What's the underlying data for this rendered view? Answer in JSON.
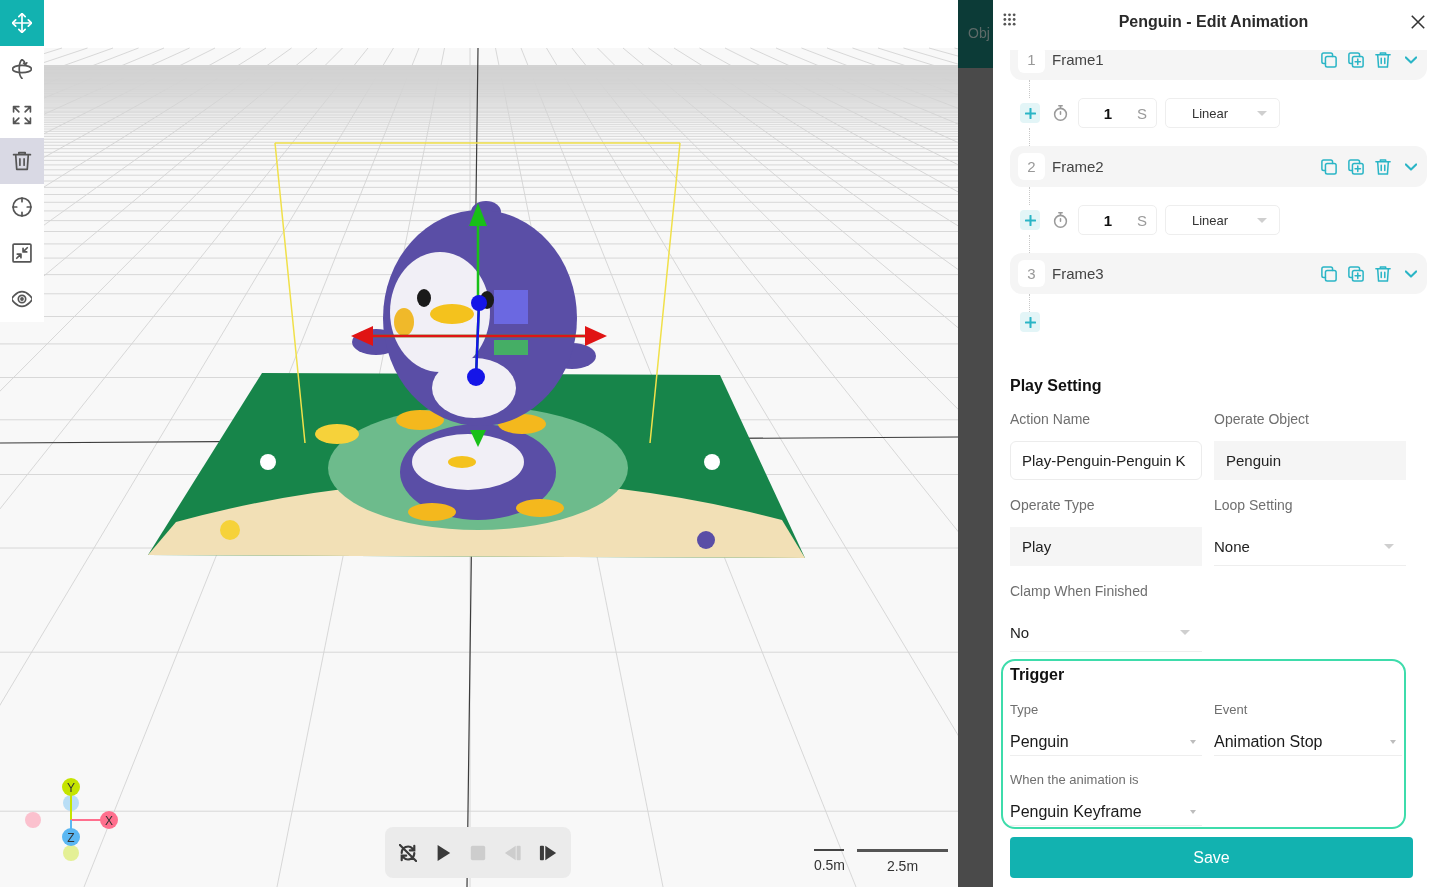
{
  "toolbar": {
    "tools": [
      {
        "kind": "move",
        "selected": true,
        "hovered": false
      },
      {
        "kind": "rotate",
        "selected": false,
        "hovered": false
      },
      {
        "kind": "scale",
        "selected": false,
        "hovered": false
      },
      {
        "kind": "delete",
        "selected": false,
        "hovered": true
      },
      {
        "kind": "focus",
        "selected": false,
        "hovered": false
      },
      {
        "kind": "fit",
        "selected": false,
        "hovered": false
      },
      {
        "kind": "visibility",
        "selected": false,
        "hovered": false
      }
    ]
  },
  "viewport": {
    "axes": [
      {
        "kind": "up",
        "label": "Y",
        "color": "#c5e400"
      },
      {
        "kind": "right",
        "label": "X",
        "color": "#ff6f8e"
      },
      {
        "kind": "down",
        "label": "Z",
        "color": "#5bb7f2"
      }
    ],
    "playback": [
      {
        "kind": "loop-off",
        "disabled": false
      },
      {
        "kind": "play",
        "disabled": false
      },
      {
        "kind": "stop",
        "disabled": true
      },
      {
        "kind": "step-back",
        "disabled": true
      },
      {
        "kind": "step-forward",
        "disabled": false
      }
    ],
    "scale_bars": [
      {
        "kind": "short",
        "label": "0.5m"
      },
      {
        "kind": "long",
        "label": "2.5m"
      }
    ]
  },
  "side_tab": {
    "label": "Obj"
  },
  "panel": {
    "title": "Penguin - Edit Animation",
    "keyframes": [
      {
        "number": "1",
        "name": "Frame1",
        "transition": {
          "duration": "1",
          "unit": "S",
          "easing": "Linear"
        }
      },
      {
        "number": "2",
        "name": "Frame2",
        "transition": {
          "duration": "1",
          "unit": "S",
          "easing": "Linear"
        }
      },
      {
        "number": "3",
        "name": "Frame3"
      }
    ],
    "play_setting": {
      "heading": "Play Setting",
      "fields": [
        {
          "kind": "input",
          "label": "Action Name",
          "value": "Play-Penguin-Penguin K"
        },
        {
          "kind": "readonly",
          "label": "Operate Object",
          "value": "Penguin"
        },
        {
          "kind": "readonly",
          "label": "Operate Type",
          "value": "Play"
        },
        {
          "kind": "select",
          "label": "Loop Setting",
          "value": "None"
        },
        {
          "kind": "select",
          "label": "Clamp When Finished",
          "value": "No"
        }
      ]
    },
    "trigger": {
      "heading": "Trigger",
      "fields": [
        {
          "kind": "select",
          "label": "Type",
          "value": "Penguin"
        },
        {
          "kind": "select",
          "label": "Event",
          "value": "Animation Stop"
        },
        {
          "kind": "select",
          "label": "When the animation is",
          "value": "Penguin Keyframe"
        }
      ]
    },
    "save_button": "Save"
  }
}
